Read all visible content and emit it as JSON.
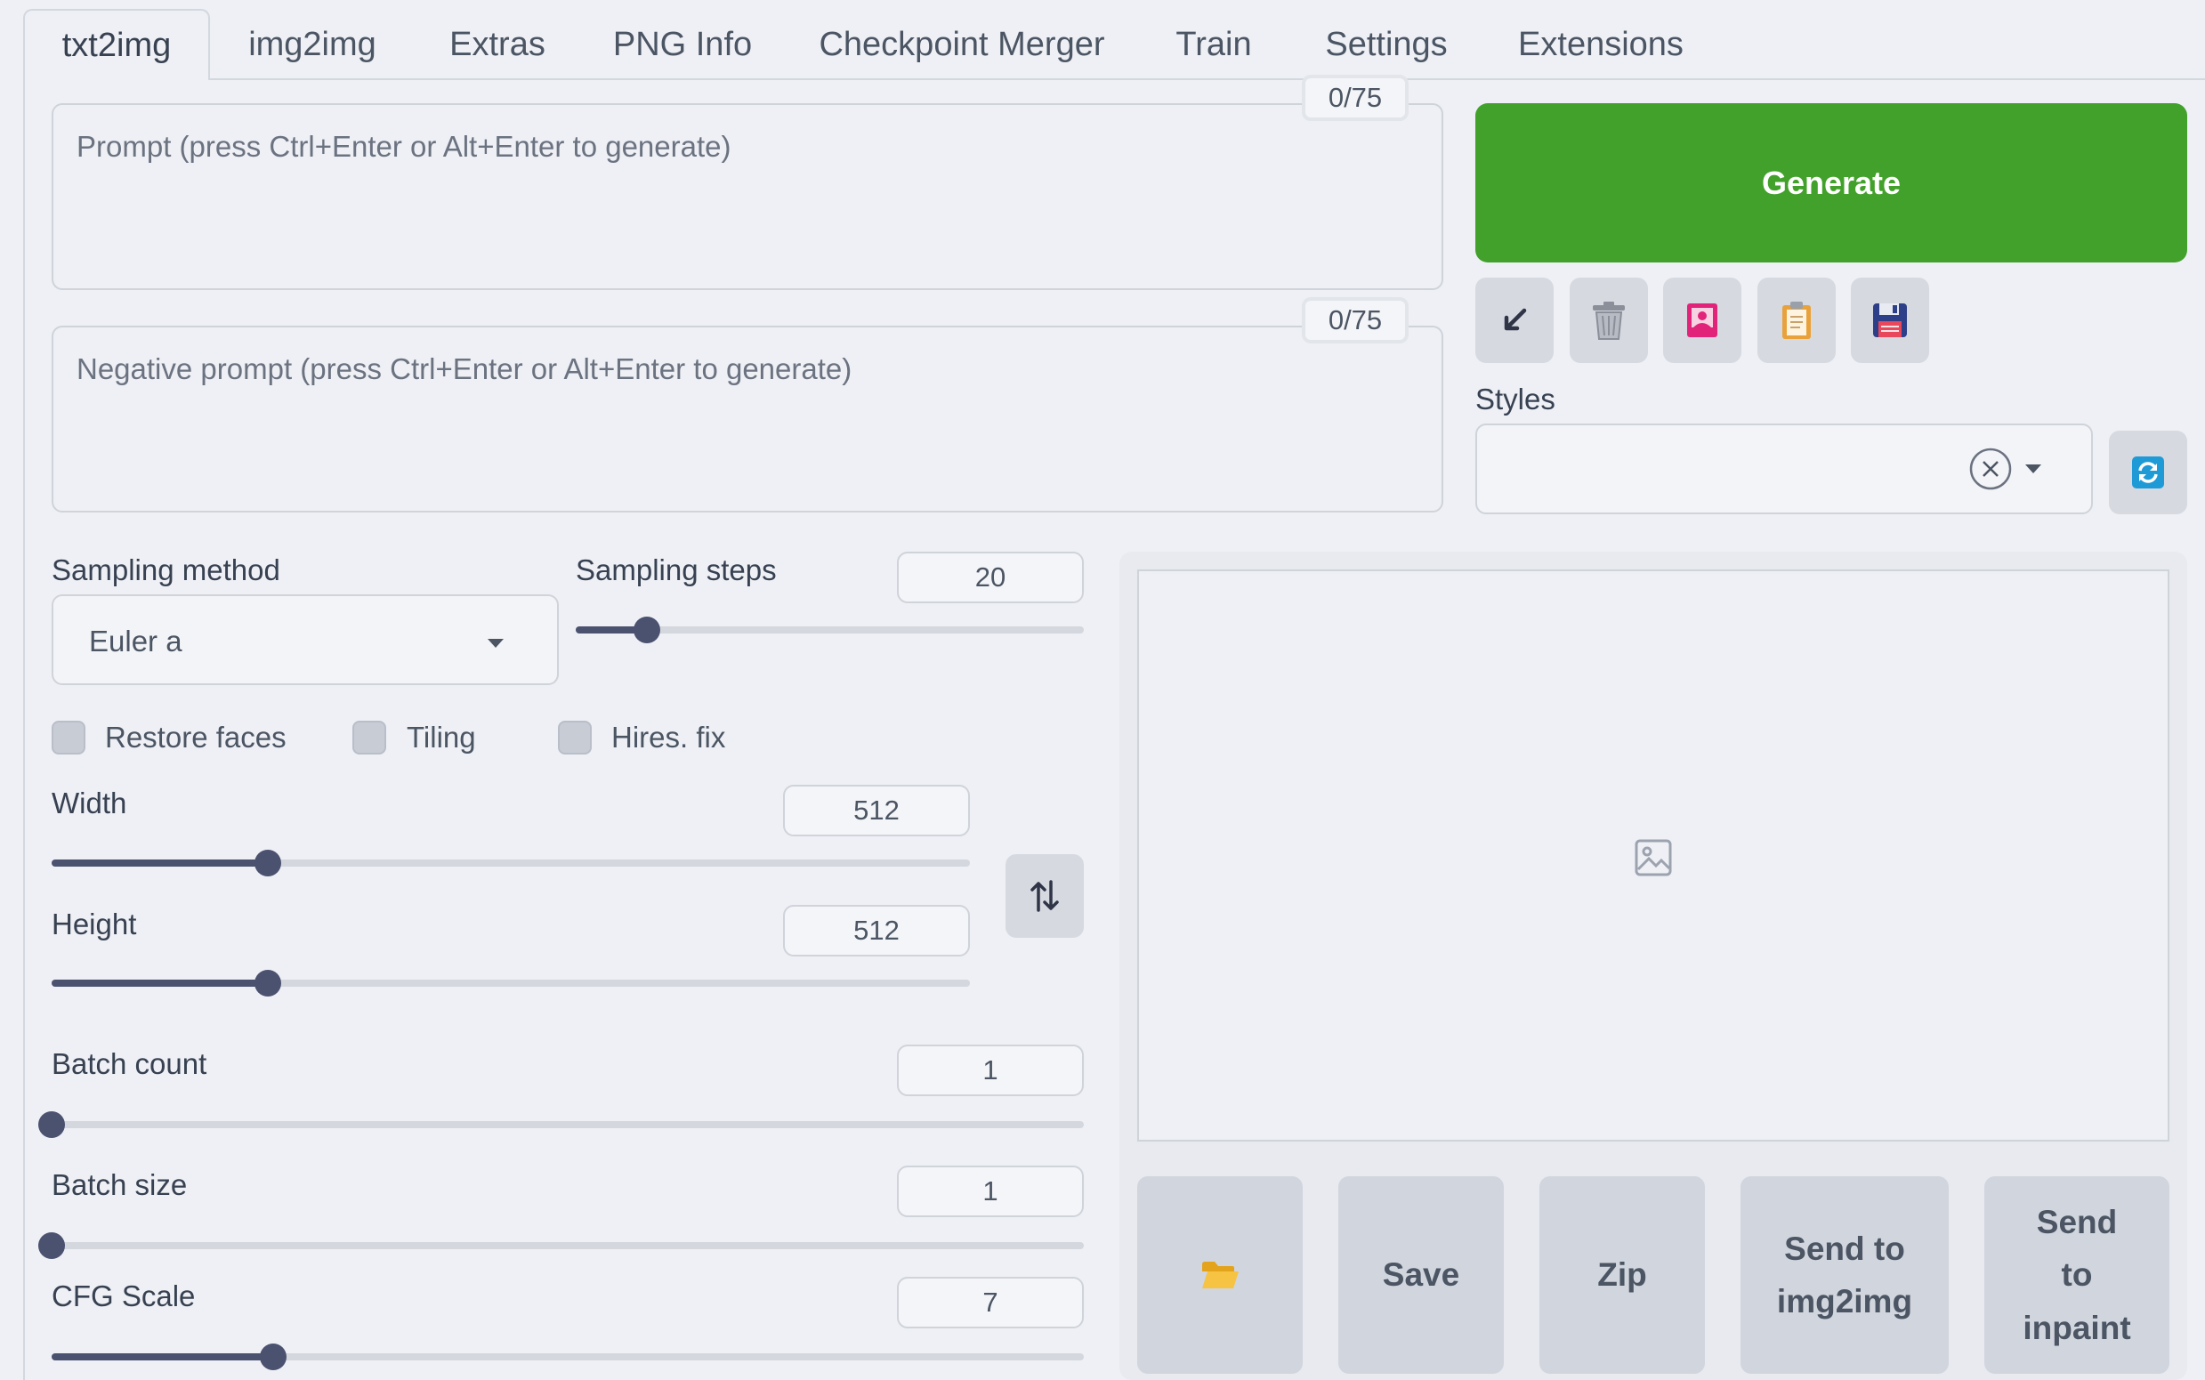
{
  "tabs": [
    "txt2img",
    "img2img",
    "Extras",
    "PNG Info",
    "Checkpoint Merger",
    "Train",
    "Settings",
    "Extensions"
  ],
  "prompt": {
    "placeholder": "Prompt (press Ctrl+Enter or Alt+Enter to generate)",
    "counter": "0/75"
  },
  "negative_prompt": {
    "placeholder": "Negative prompt (press Ctrl+Enter or Alt+Enter to generate)",
    "counter": "0/75"
  },
  "generate_label": "Generate",
  "tool_icons": [
    "arrow-down-left-icon",
    "trash-icon",
    "picture-icon",
    "clipboard-icon",
    "save-disk-icon"
  ],
  "styles": {
    "label": "Styles",
    "value": ""
  },
  "sampling_method": {
    "label": "Sampling method",
    "value": "Euler a"
  },
  "sampling_steps": {
    "label": "Sampling steps",
    "value": "20",
    "fraction": 0.14
  },
  "checkboxes": [
    {
      "label": "Restore faces",
      "checked": false
    },
    {
      "label": "Tiling",
      "checked": false
    },
    {
      "label": "Hires. fix",
      "checked": false
    }
  ],
  "width": {
    "label": "Width",
    "value": "512",
    "fraction": 0.235
  },
  "height": {
    "label": "Height",
    "value": "512",
    "fraction": 0.235
  },
  "batch_count": {
    "label": "Batch count",
    "value": "1",
    "fraction": 0.0
  },
  "batch_size": {
    "label": "Batch size",
    "value": "1",
    "fraction": 0.0
  },
  "cfg_scale": {
    "label": "CFG Scale",
    "value": "7",
    "fraction": 0.215
  },
  "actions": {
    "folder_icon": "folder-icon",
    "save": "Save",
    "zip": "Zip",
    "send_img2img": "Send to img2img",
    "send_inpaint": "Send to inpaint"
  },
  "colors": {
    "generate": "#42a12a",
    "accent_blue": "#1e9bd7",
    "slider": "#4b5270"
  }
}
